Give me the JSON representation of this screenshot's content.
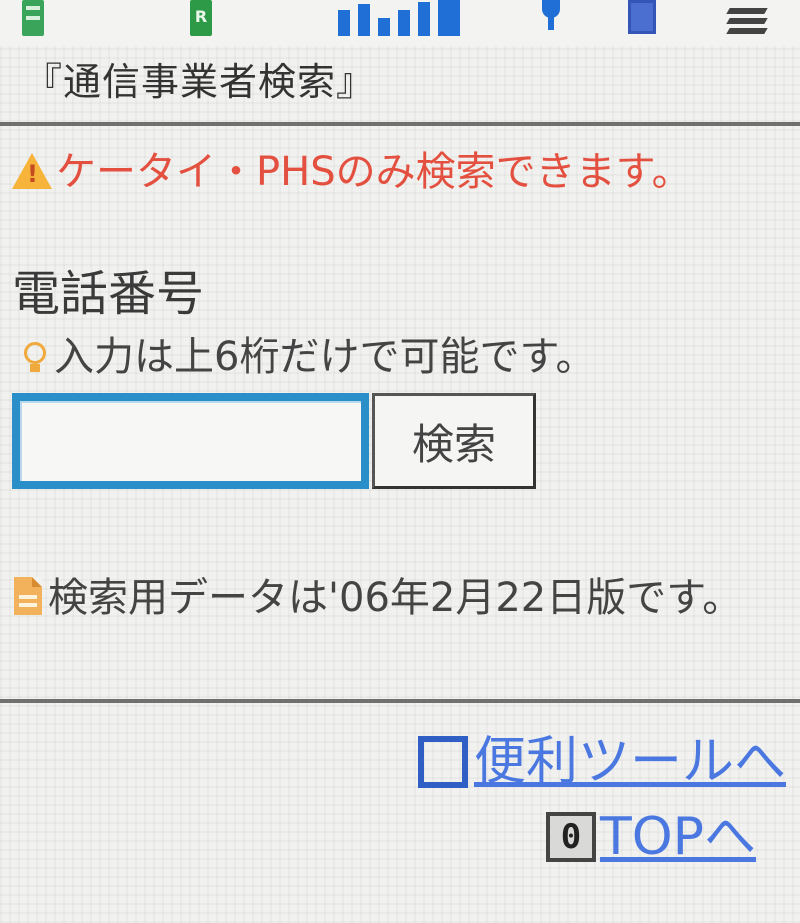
{
  "status_bar": {
    "icons": [
      "mail-icon",
      "app-icon",
      "signal-strength-icon",
      "cursor-icon",
      "battery-icon",
      "sync-icon"
    ],
    "app_icon_letter": "R"
  },
  "header": {
    "title": "『通信事業者検索』"
  },
  "warning": {
    "icon": "warning-icon",
    "text": "ケータイ・PHSのみ検索できます。"
  },
  "form": {
    "label": "電話番号",
    "hint_icon": "bulb-icon",
    "hint": "入力は上6桁だけで可能です。",
    "input_value": "",
    "search_button_label": "検索"
  },
  "data_info": {
    "icon": "document-icon",
    "text": "検索用データは'06年2月22日版です。"
  },
  "footer": {
    "tools_link_label": "便利ツールへ",
    "top_key_label": "0",
    "top_link_label": "TOPへ"
  },
  "colors": {
    "warning_text": "#e4503f",
    "link": "#4a78e0",
    "input_border": "#2a8ec8",
    "divider": "#707070"
  }
}
